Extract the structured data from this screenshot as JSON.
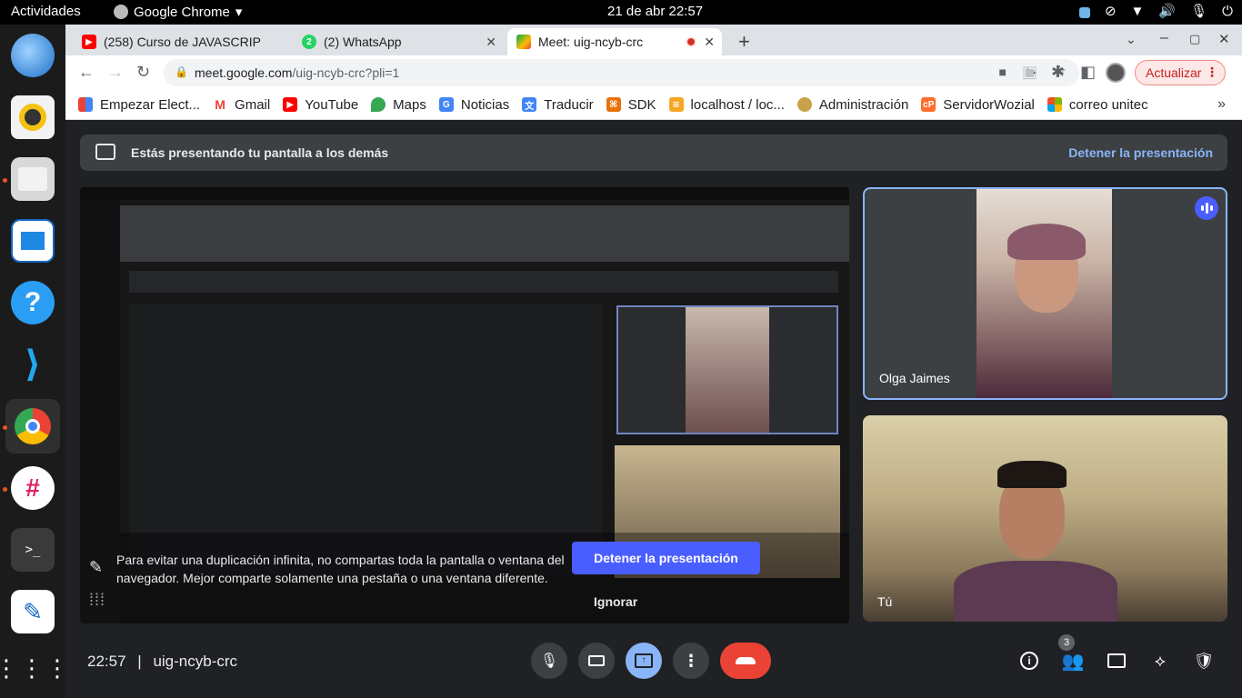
{
  "topbar": {
    "activities": "Actividades",
    "app_name": "Google Chrome",
    "clock": "21 de abr  22:57"
  },
  "tabs": [
    {
      "title": "(258) Curso de JAVASCRIP",
      "icon": "youtube-icon"
    },
    {
      "title": "(2) WhatsApp",
      "icon": "whatsapp-icon"
    },
    {
      "title": "Meet: uig-ncyb-crc",
      "icon": "meet-icon",
      "active": true
    }
  ],
  "toolbar": {
    "url_host": "meet.google.com",
    "url_path": "/uig-ncyb-crc?pli=1",
    "update_label": "Actualizar"
  },
  "bookmarks": [
    {
      "label": "Empezar Elect...",
      "icon": "flag-icon"
    },
    {
      "label": "Gmail",
      "icon": "gmail-icon"
    },
    {
      "label": "YouTube",
      "icon": "youtube-icon"
    },
    {
      "label": "Maps",
      "icon": "maps-icon"
    },
    {
      "label": "Noticias",
      "icon": "news-icon"
    },
    {
      "label": "Traducir",
      "icon": "translate-icon"
    },
    {
      "label": "SDK",
      "icon": "sdk-icon"
    },
    {
      "label": "localhost / loc...",
      "icon": "phpmyadmin-icon"
    },
    {
      "label": "Administración",
      "icon": "admin-icon"
    },
    {
      "label": "ServidorWozial",
      "icon": "cpanel-icon"
    },
    {
      "label": "correo unitec",
      "icon": "microsoft-icon"
    }
  ],
  "banner": {
    "text": "Estás presentando tu pantalla a los demás",
    "stop": "Detener la presentación"
  },
  "overlay": {
    "message": "Para evitar una duplicación infinita, no compartas toda la pantalla o ventana del navegador. Mejor comparte solamente una pestaña o una ventana diferente.",
    "stop_button": "Detener la presentación",
    "ignore_button": "Ignorar"
  },
  "participants": {
    "olga": "Olga Jaimes",
    "you": "Tú"
  },
  "bottom": {
    "time": "22:57",
    "separator": "|",
    "meeting_code": "uig-ncyb-crc",
    "participant_count": "3"
  },
  "colors": {
    "meet_bg": "#202124",
    "accent": "#8ab4f8",
    "leave": "#ea4335",
    "present_button": "#4a5eff"
  }
}
